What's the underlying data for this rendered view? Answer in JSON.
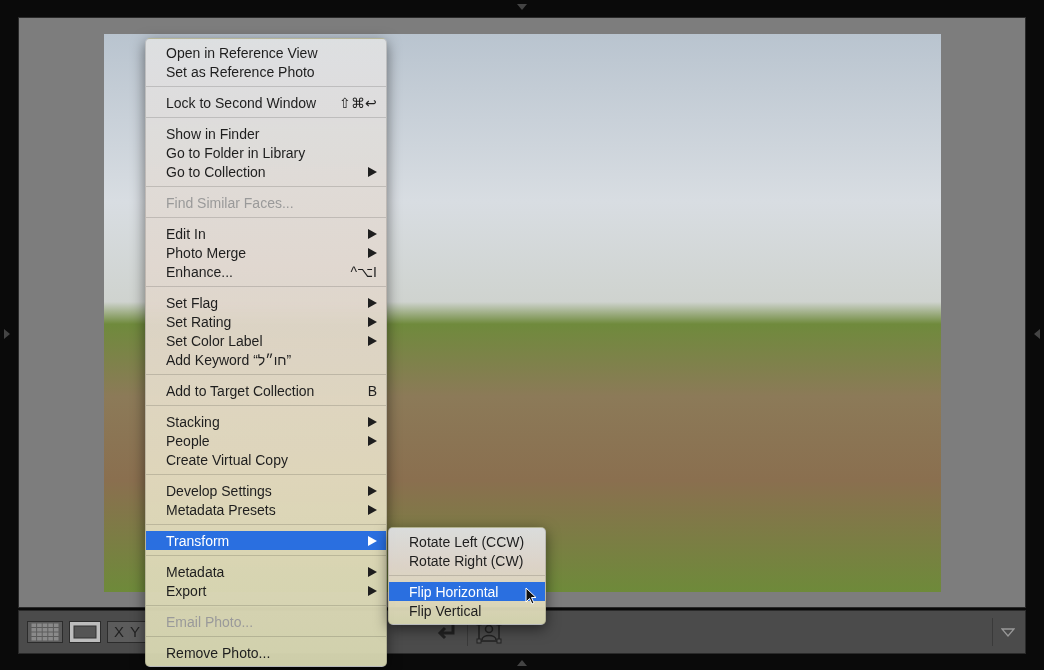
{
  "context_menu": {
    "groups": [
      [
        {
          "label": "Open in Reference View",
          "submenu": false,
          "disabled": false,
          "selected": false
        },
        {
          "label": "Set as Reference Photo",
          "submenu": false,
          "disabled": false,
          "selected": false
        }
      ],
      [
        {
          "label": "Lock to Second Window",
          "shortcut": "⇧⌘↩",
          "submenu": false,
          "disabled": false,
          "selected": false
        }
      ],
      [
        {
          "label": "Show in Finder",
          "submenu": false,
          "disabled": false,
          "selected": false
        },
        {
          "label": "Go to Folder in Library",
          "submenu": false,
          "disabled": false,
          "selected": false
        },
        {
          "label": "Go to Collection",
          "submenu": true,
          "disabled": false,
          "selected": false
        }
      ],
      [
        {
          "label": "Find Similar Faces...",
          "submenu": false,
          "disabled": true,
          "selected": false
        }
      ],
      [
        {
          "label": "Edit In",
          "submenu": true,
          "disabled": false,
          "selected": false
        },
        {
          "label": "Photo Merge",
          "submenu": true,
          "disabled": false,
          "selected": false
        },
        {
          "label": "Enhance...",
          "shortcut": "^⌥I",
          "submenu": false,
          "disabled": false,
          "selected": false
        }
      ],
      [
        {
          "label": "Set Flag",
          "submenu": true,
          "disabled": false,
          "selected": false
        },
        {
          "label": "Set Rating",
          "submenu": true,
          "disabled": false,
          "selected": false
        },
        {
          "label": "Set Color Label",
          "submenu": true,
          "disabled": false,
          "selected": false
        },
        {
          "label": "Add Keyword “חו״ל”",
          "submenu": false,
          "disabled": false,
          "selected": false
        }
      ],
      [
        {
          "label": "Add to Target Collection",
          "shortcut": "B",
          "submenu": false,
          "disabled": false,
          "selected": false
        }
      ],
      [
        {
          "label": "Stacking",
          "submenu": true,
          "disabled": false,
          "selected": false
        },
        {
          "label": "People",
          "submenu": true,
          "disabled": false,
          "selected": false
        },
        {
          "label": "Create Virtual Copy",
          "submenu": false,
          "disabled": false,
          "selected": false
        }
      ],
      [
        {
          "label": "Develop Settings",
          "submenu": true,
          "disabled": false,
          "selected": false
        },
        {
          "label": "Metadata Presets",
          "submenu": true,
          "disabled": false,
          "selected": false
        }
      ],
      [
        {
          "label": "Transform",
          "submenu": true,
          "disabled": false,
          "selected": true
        }
      ],
      [
        {
          "label": "Metadata",
          "submenu": true,
          "disabled": false,
          "selected": false
        },
        {
          "label": "Export",
          "submenu": true,
          "disabled": false,
          "selected": false
        }
      ],
      [
        {
          "label": "Email Photo...",
          "submenu": false,
          "disabled": true,
          "selected": false
        }
      ],
      [
        {
          "label": "Remove Photo...",
          "submenu": false,
          "disabled": false,
          "selected": false
        }
      ]
    ]
  },
  "submenu": {
    "groups": [
      [
        {
          "label": "Rotate Left (CCW)",
          "selected": false
        },
        {
          "label": "Rotate Right (CW)",
          "selected": false
        }
      ],
      [
        {
          "label": "Flip Horizontal",
          "selected": true
        },
        {
          "label": "Flip Vertical",
          "selected": false
        }
      ]
    ]
  },
  "toolbar": {
    "view_modes": [
      {
        "kind": "grid",
        "selected": false
      },
      {
        "kind": "loupe",
        "selected": true
      },
      {
        "kind": "compare",
        "selected": false
      }
    ],
    "compare_labels": [
      "X",
      "Y"
    ]
  }
}
